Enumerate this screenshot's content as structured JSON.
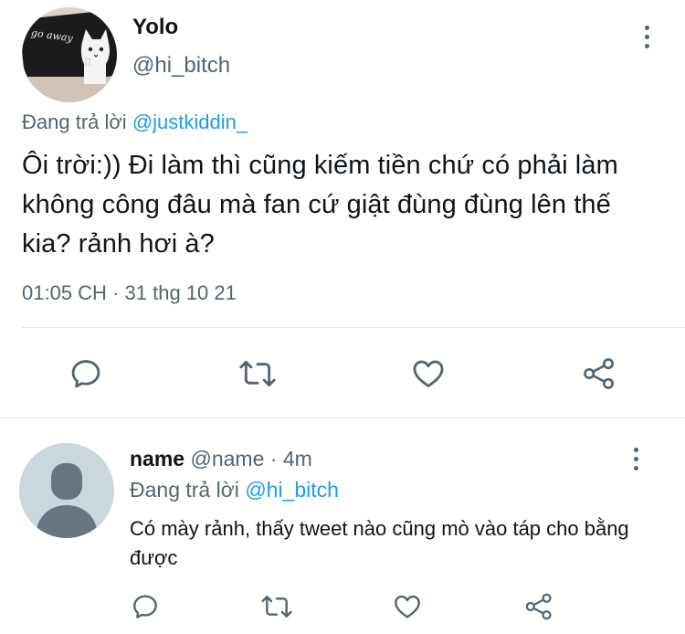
{
  "tweet": {
    "author": {
      "name": "Yolo",
      "handle": "@hi_bitch",
      "avatar_caption": "go away"
    },
    "replying_to": {
      "prefix": "Đang trả lời ",
      "mention": "@justkiddin_"
    },
    "text": "Ôi trời:)) Đi làm thì cũng kiếm tiền chứ có phải làm không công đâu mà fan cứ giật đùng đùng lên thế kia? rảnh hơi à?",
    "time": "01:05 CH",
    "separator": " · ",
    "date": "31 thg 10 21",
    "actions": [
      "reply-icon",
      "retweet-icon",
      "like-icon",
      "share-icon"
    ]
  },
  "reply": {
    "author": {
      "name": "name",
      "handle": "@name",
      "separator": " · ",
      "time": "4m"
    },
    "replying_to": {
      "prefix": "Đang trả lời ",
      "mention": "@hi_bitch"
    },
    "text": "Có mày rảnh, thấy tweet nào cũng mò vào táp cho bằng được",
    "actions": [
      "reply-icon",
      "retweet-icon",
      "like-icon",
      "share-icon"
    ]
  },
  "colors": {
    "primary_text": "#0f1419",
    "secondary_text": "#536471",
    "accent": "#1d9bf0",
    "divider": "#dfe4e8"
  }
}
